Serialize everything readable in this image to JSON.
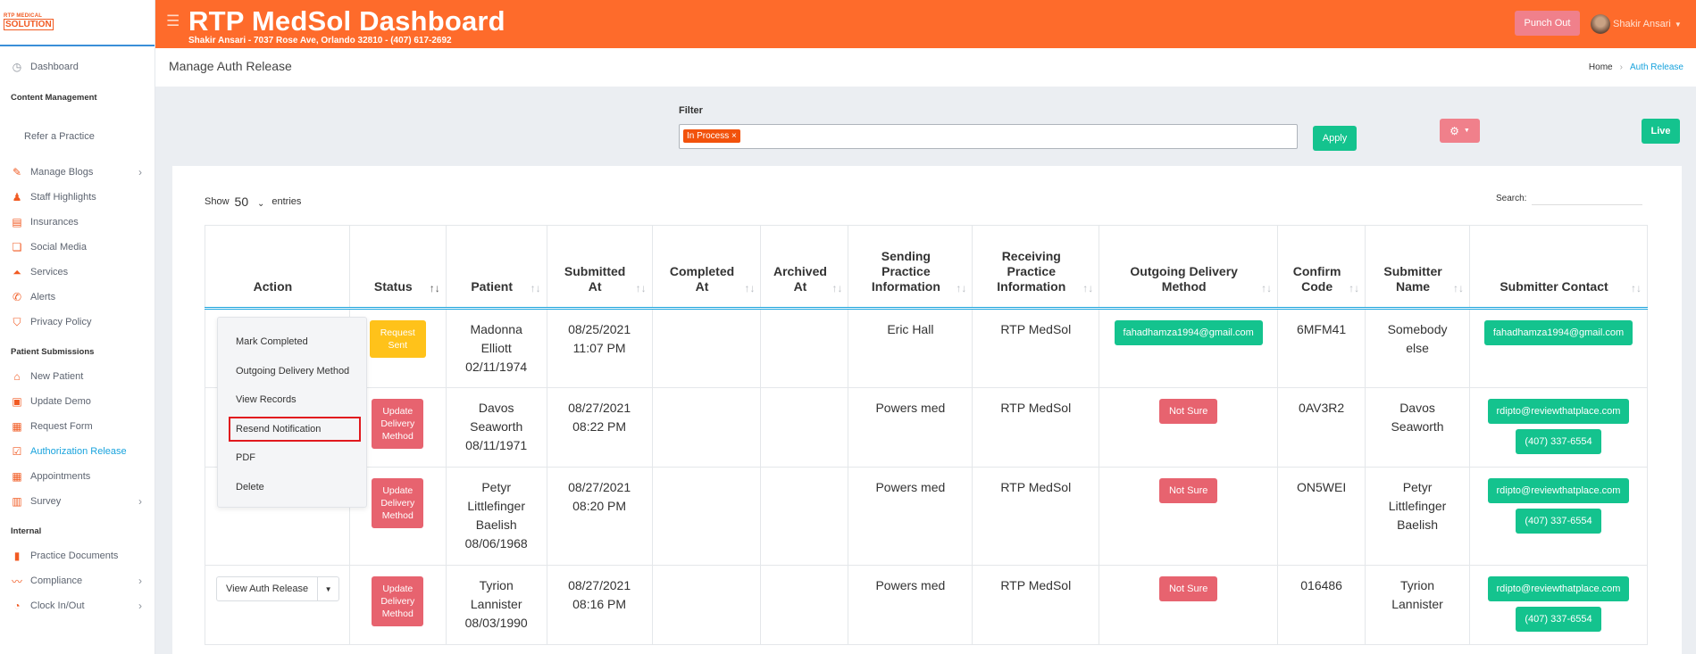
{
  "sidebar": {
    "logo_top": "RTP MEDICAL",
    "logo_bottom": "SOLUTION",
    "dashboard": "Dashboard",
    "content_heading": "Content Management",
    "refer": "Refer a Practice",
    "items_content": [
      {
        "label": "Manage Blogs",
        "chev": true
      },
      {
        "label": "Staff Highlights"
      },
      {
        "label": "Insurances"
      },
      {
        "label": "Social Media"
      },
      {
        "label": "Services"
      },
      {
        "label": "Alerts"
      },
      {
        "label": "Privacy Policy"
      }
    ],
    "patient_heading": "Patient Submissions",
    "items_patient": [
      {
        "label": "New Patient"
      },
      {
        "label": "Update Demo"
      },
      {
        "label": "Request Form"
      },
      {
        "label": "Authorization Release",
        "active": true
      },
      {
        "label": "Appointments"
      },
      {
        "label": "Survey",
        "chev": true
      }
    ],
    "internal_heading": "Internal",
    "items_internal": [
      {
        "label": "Practice Documents"
      },
      {
        "label": "Compliance",
        "chev": true
      },
      {
        "label": "Clock In/Out",
        "chev": true
      }
    ]
  },
  "header": {
    "title": "RTP MedSol Dashboard",
    "subtitle": "Shakir Ansari - 7037 Rose Ave, Orlando 32810 - (407) 617-2692",
    "punch_out": "Punch Out",
    "user_name": "Shakir Ansari"
  },
  "page": {
    "title": "Manage Auth Release",
    "breadcrumb_home": "Home",
    "breadcrumb_current": "Auth Release"
  },
  "filter": {
    "label": "Filter",
    "chip": "In Process ×",
    "apply": "Apply",
    "live": "Live"
  },
  "table_controls": {
    "show": "Show",
    "entries_value": "50",
    "entries": "entries",
    "search": "Search:"
  },
  "columns": [
    {
      "label": "Action",
      "lines": [
        "Action"
      ]
    },
    {
      "label": "Status",
      "lines": [
        "Status"
      ]
    },
    {
      "label": "Patient",
      "lines": [
        "Patient"
      ]
    },
    {
      "label": "Submitted At",
      "lines": [
        "Submitted",
        "At"
      ]
    },
    {
      "label": "Completed At",
      "lines": [
        "Completed",
        "At"
      ]
    },
    {
      "label": "Archived At",
      "lines": [
        "Archived",
        "At"
      ]
    },
    {
      "label": "Sending Practice Information",
      "lines": [
        "Sending",
        "Practice",
        "Information"
      ]
    },
    {
      "label": "Receiving Practice Information",
      "lines": [
        "Receiving",
        "Practice",
        "Information"
      ]
    },
    {
      "label": "Outgoing Delivery Method",
      "lines": [
        "Outgoing Delivery",
        "Method"
      ]
    },
    {
      "label": "Confirm Code",
      "lines": [
        "Confirm",
        "Code"
      ]
    },
    {
      "label": "Submitter Name",
      "lines": [
        "Submitter",
        "Name"
      ]
    },
    {
      "label": "Submitter Contact",
      "lines": [
        "Submitter Contact"
      ]
    }
  ],
  "rows": [
    {
      "action": "",
      "status": [
        "Request",
        "Sent"
      ],
      "status_color": "yellow",
      "patient": [
        "Madonna",
        "Elliott",
        "02/11/1974"
      ],
      "submitted": [
        "08/25/2021",
        "11:07 PM"
      ],
      "completed": "",
      "archived": "",
      "sending": "Eric Hall",
      "receiving": "RTP MedSol",
      "delivery": "fahadhamza1994@gmail.com",
      "delivery_color": "green",
      "code": "6MFM41",
      "submitter": [
        "Somebody",
        "else"
      ],
      "contact": [
        "fahadhamza1994@gmail.com"
      ]
    },
    {
      "action": "",
      "status": [
        "Update",
        "Delivery",
        "Method"
      ],
      "status_color": "red",
      "patient": [
        "Davos",
        "Seaworth",
        "08/11/1971"
      ],
      "submitted": [
        "08/27/2021",
        "08:22 PM"
      ],
      "completed": "",
      "archived": "",
      "sending": "Powers med",
      "receiving": "RTP MedSol",
      "delivery": "Not Sure",
      "delivery_color": "red",
      "code": "0AV3R2",
      "submitter": [
        "Davos",
        "Seaworth"
      ],
      "contact": [
        "rdipto@reviewthatplace.com",
        "(407) 337-6554"
      ]
    },
    {
      "action": "",
      "status": [
        "Update",
        "Delivery",
        "Method"
      ],
      "status_color": "red",
      "patient": [
        "Petyr",
        "Littlefinger",
        "Baelish",
        "08/06/1968"
      ],
      "submitted": [
        "08/27/2021",
        "08:20 PM"
      ],
      "completed": "",
      "archived": "",
      "sending": "Powers med",
      "receiving": "RTP MedSol",
      "delivery": "Not Sure",
      "delivery_color": "red",
      "code": "ON5WEI",
      "submitter": [
        "Petyr",
        "Littlefinger",
        "Baelish"
      ],
      "contact": [
        "rdipto@reviewthatplace.com",
        "(407) 337-6554"
      ]
    },
    {
      "action": "View Auth Release",
      "status": [
        "Update",
        "Delivery",
        "Method"
      ],
      "status_color": "red",
      "patient": [
        "Tyrion",
        "Lannister",
        "08/03/1990"
      ],
      "submitted": [
        "08/27/2021",
        "08:16 PM"
      ],
      "completed": "",
      "archived": "",
      "sending": "Powers med",
      "receiving": "RTP MedSol",
      "delivery": "Not Sure",
      "delivery_color": "red",
      "code": "016486",
      "submitter": [
        "Tyrion",
        "Lannister"
      ],
      "contact": [
        "rdipto@reviewthatplace.com",
        "(407) 337-6554"
      ]
    }
  ],
  "dropdown": {
    "items": [
      "Mark Completed",
      "Outgoing Delivery Method",
      "View Records",
      "Resend Notification",
      "PDF",
      "Delete"
    ],
    "highlighted": "Resend Notification"
  },
  "colors": {
    "header": "#fe6b2b",
    "accent": "#18a3dd",
    "green": "#14c38e",
    "red": "#e7636f",
    "yellow": "#ffc21a",
    "highlight": "#e1191e"
  },
  "icons": {
    "dashboard": "gauge-icon",
    "menu": "hamburger-icon",
    "settings": "gear-icon",
    "sort": "sort-arrows-icon"
  }
}
